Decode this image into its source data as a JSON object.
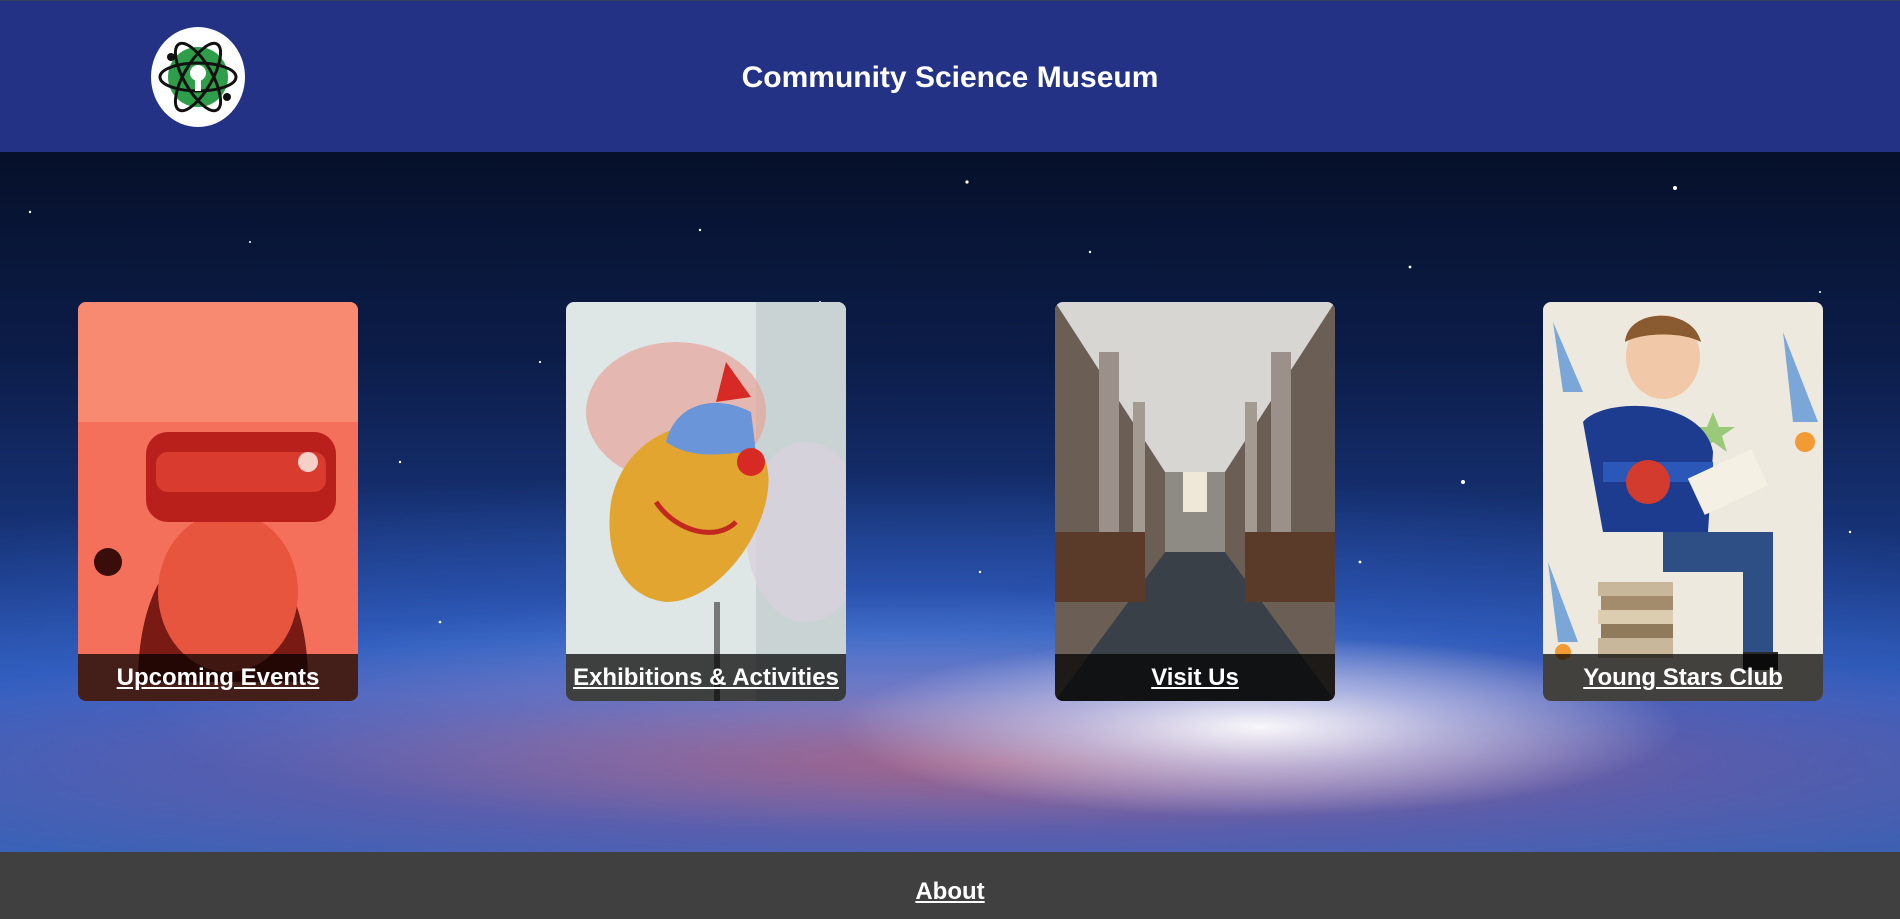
{
  "header": {
    "logo_icon": "atom-logo-icon",
    "title": "Community Science Museum",
    "background_color": "#233284"
  },
  "cards": [
    {
      "label": "Upcoming Events",
      "image": "child-vr-headset-photo"
    },
    {
      "label": "Exhibitions & Activities",
      "image": "anatomical-heart-model-photo"
    },
    {
      "label": "Visit Us",
      "image": "museum-gallery-hall-photo"
    },
    {
      "label": "Young Stars Club",
      "image": "child-reading-book-rockets-photo"
    }
  ],
  "footer": {
    "about_label": "About",
    "background_color": "#404040"
  }
}
